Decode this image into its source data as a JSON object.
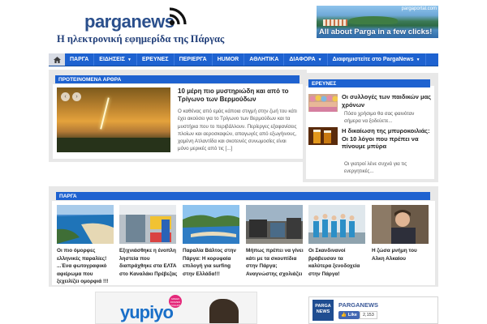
{
  "header": {
    "logo_text": "parganews",
    "tagline": "Η ηλεκτρονική εφημερίδα της Πάργας",
    "banner_url": "pargaportal.com",
    "banner_text": "All about Parga in a few clicks!"
  },
  "nav": {
    "items": [
      {
        "label": "ΠΑΡΓΑ",
        "has_caret": false
      },
      {
        "label": "ΕΙΔΗΣΕΙΣ",
        "has_caret": true
      },
      {
        "label": "ΕΡΕΥΝΕΣ",
        "has_caret": false
      },
      {
        "label": "ΠΕΡΙΕΡΓΑ",
        "has_caret": false
      },
      {
        "label": "HUMOR",
        "has_caret": false
      },
      {
        "label": "ΑΘΛΗΤΙΚΑ",
        "has_caret": false
      },
      {
        "label": "ΔΙΑΦΟΡΑ",
        "has_caret": true
      },
      {
        "label": "Διαφημιστείτε στο PargaNews",
        "has_caret": true
      }
    ],
    "caret": "▼"
  },
  "featured": {
    "heading": "ΠΡΟΤΕΙΝΟΜΕΝΑ ΑΡΘΡΑ",
    "title": "10 μέρη πιο μυστηριώδη και από το Τρίγωνο των Βερμούδων",
    "excerpt": "Ο καθένας από εμάς κάποια στιγμή στην ζωή του κάτι έχει ακούσει για το Τρίγωνο των Βερμούδων και τα μυστήρια που το περιβάλλουν. Περίεργες εξαφανίσεις πλοίων και αεροσκαφών, απαγωγές από εξωγήινους, χαμένη Ατλαντίδα και σκοτεινές συνωμοσίες είναι μόνο μερικές από τις [...]",
    "prev": "‹",
    "next": "›"
  },
  "research": {
    "heading": "ΕΡΕΥΝΕΣ",
    "items": [
      {
        "title": "Οι συλλογές των παιδικών μας χρόνων",
        "excerpt": "Πόσο χρήσιμο θα σας φαινόταν σήμερα να ξοδεύετε..."
      },
      {
        "title": "Η δικαίωση της μπυροκοιλιάς: Οι 10 λόγοι που πρέπει να πίνουμε μπύρα",
        "excerpt": "Οι γιατροί λένε συχνά για τις ενεργητικές..."
      }
    ]
  },
  "parga": {
    "heading": "ΠΑΡΓΑ",
    "items": [
      {
        "caption": "Οι πιο όμορφες ελληνικές παραλίες! ...Ένα φωτογραφικό αφιέρωμα που ξεχειλίζει ομορφιά !!!"
      },
      {
        "caption": "Εξιχνιάσθηκε η ένοπλη ληστεία που διαπράχθηκε στα ΕΛΤΑ στο Καναλάκι Πρέβεζας"
      },
      {
        "caption": "Παραλία Βάλτος στην Πάργα: Η κορυφαία επιλογή για surfing στην Ελλάδα!!!"
      },
      {
        "caption": "Μήπως πρέπει να γίνει κάτι με τα σκουπίδια στην Πάργα; Αναγνώστης σχολιάζει"
      },
      {
        "caption": "Οι Σκανδινανοί βράβευσαν τα καλύτερα ξενοδοχεία στην Πάργα!"
      },
      {
        "caption": "Η ζώσα μνήμη του Αλκη Αλκαίου"
      }
    ]
  },
  "ad": {
    "brand": "yupiyo",
    "badge": "GREEK FROZEN YOGURT"
  },
  "facebook": {
    "logo": "PARGA NEWS",
    "name": "PARGANEWS",
    "like": "Like",
    "count": "2,153"
  },
  "colors": {
    "brand_blue": "#1e62d0",
    "logo_blue": "#2a4f8c",
    "facebook_blue": "#3b5998"
  }
}
